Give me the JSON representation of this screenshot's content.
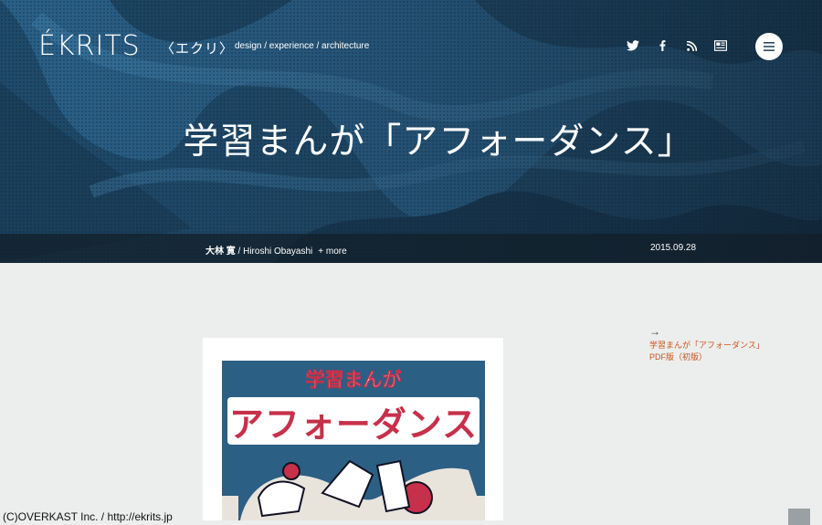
{
  "header": {
    "logo": "ÉKRITS",
    "logo_kana": "〈エクリ〉",
    "tagline": "design / experience / architecture",
    "social_icons": [
      "twitter-icon",
      "facebook-icon",
      "rss-icon",
      "feedly-icon"
    ],
    "menu_icon": "hamburger-menu-icon"
  },
  "article": {
    "title": "学習まんが「アフォーダンス」",
    "author_jp": "大林 寛",
    "author_en": " / Hiroshi Obayashi",
    "more": "+ more",
    "date": "2015.09.28"
  },
  "figure": {
    "cover_title_top": "学習まんが",
    "cover_title_main": "アフォーダンス"
  },
  "sidebar": {
    "arrow": "→",
    "link_line1": "学習まんが「アフォーダンス」",
    "link_line2": "PDF版（初版）"
  },
  "footer": {
    "credit": "(C)OVERKAST Inc.  /  http://ekrits.jp"
  },
  "colors": {
    "hero_blue": "#2a6088",
    "link_orange": "#c8531c",
    "page_bg": "#eceeed"
  }
}
